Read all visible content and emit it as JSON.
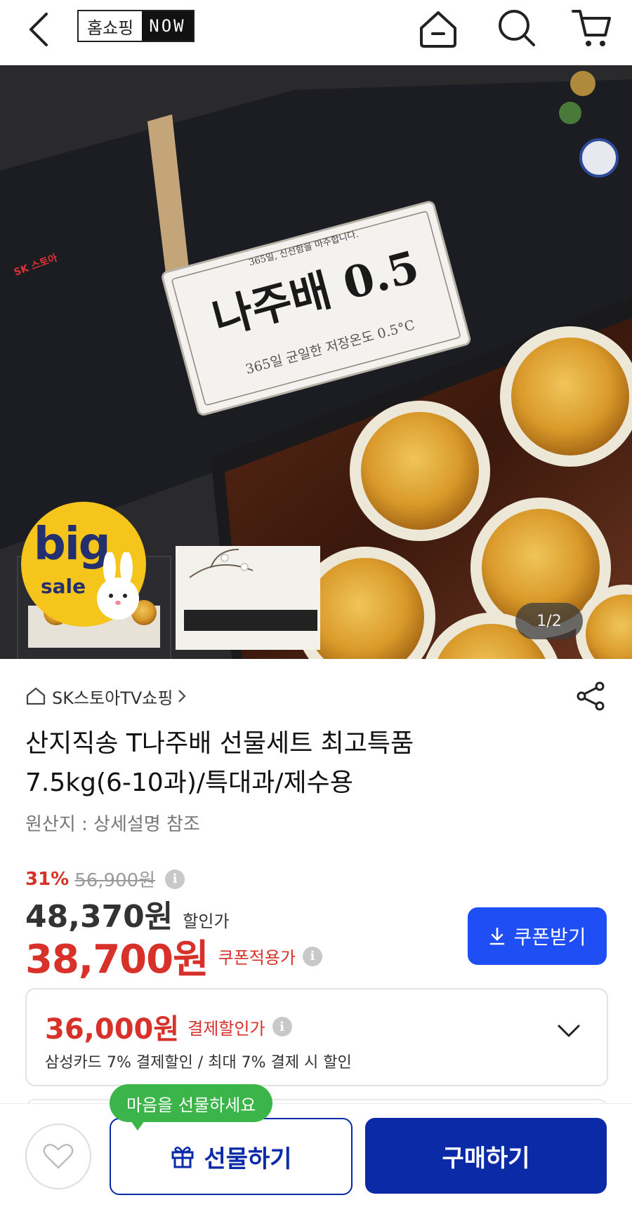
{
  "header": {
    "logo_text_a": "홈쇼핑",
    "logo_text_b": "NOW",
    "icons": [
      "back-icon",
      "home-icon",
      "search-icon",
      "cart-icon"
    ]
  },
  "hero": {
    "pager": "1/2",
    "box_brand": "SK 스토아",
    "box_subtitle": "365일, 신선함을 마주합니다.",
    "box_title": "나주배 0.5",
    "box_caption": "365일 균일한 저장온도 0.5°C",
    "badge_big": "big",
    "badge_sale": "sale"
  },
  "product": {
    "store": "SK스토아TV쇼핑",
    "title_line1": "산지직송 T나주배 선물세트 최고특품",
    "title_line2": "7.5kg(6-10과)/특대과/제수용",
    "origin": "원산지 : 상세설명 참조"
  },
  "price": {
    "discount_pct": "31%",
    "original": "56,900원",
    "sale_price": "48,370원",
    "sale_label": "할인가",
    "coupon_price": "38,700원",
    "coupon_label": "쿠폰적용가",
    "coupon_button": "쿠폰받기",
    "info_glyph": "i"
  },
  "payment": {
    "amount": "36,000원",
    "label": "결제할인가",
    "detail": "삼성카드 7% 결제할인 / 최대 7% 결제 시 할인"
  },
  "bottom": {
    "tooltip": "마음을 선물하세요",
    "gift_button": "선물하기",
    "buy_button": "구매하기"
  },
  "colors": {
    "accent_red": "#d7312a",
    "coupon_blue": "#1f4ef5",
    "buy_navy": "#0b2aa8",
    "tooltip_green": "#3bb54a",
    "badge_yellow": "#f5c51c"
  }
}
